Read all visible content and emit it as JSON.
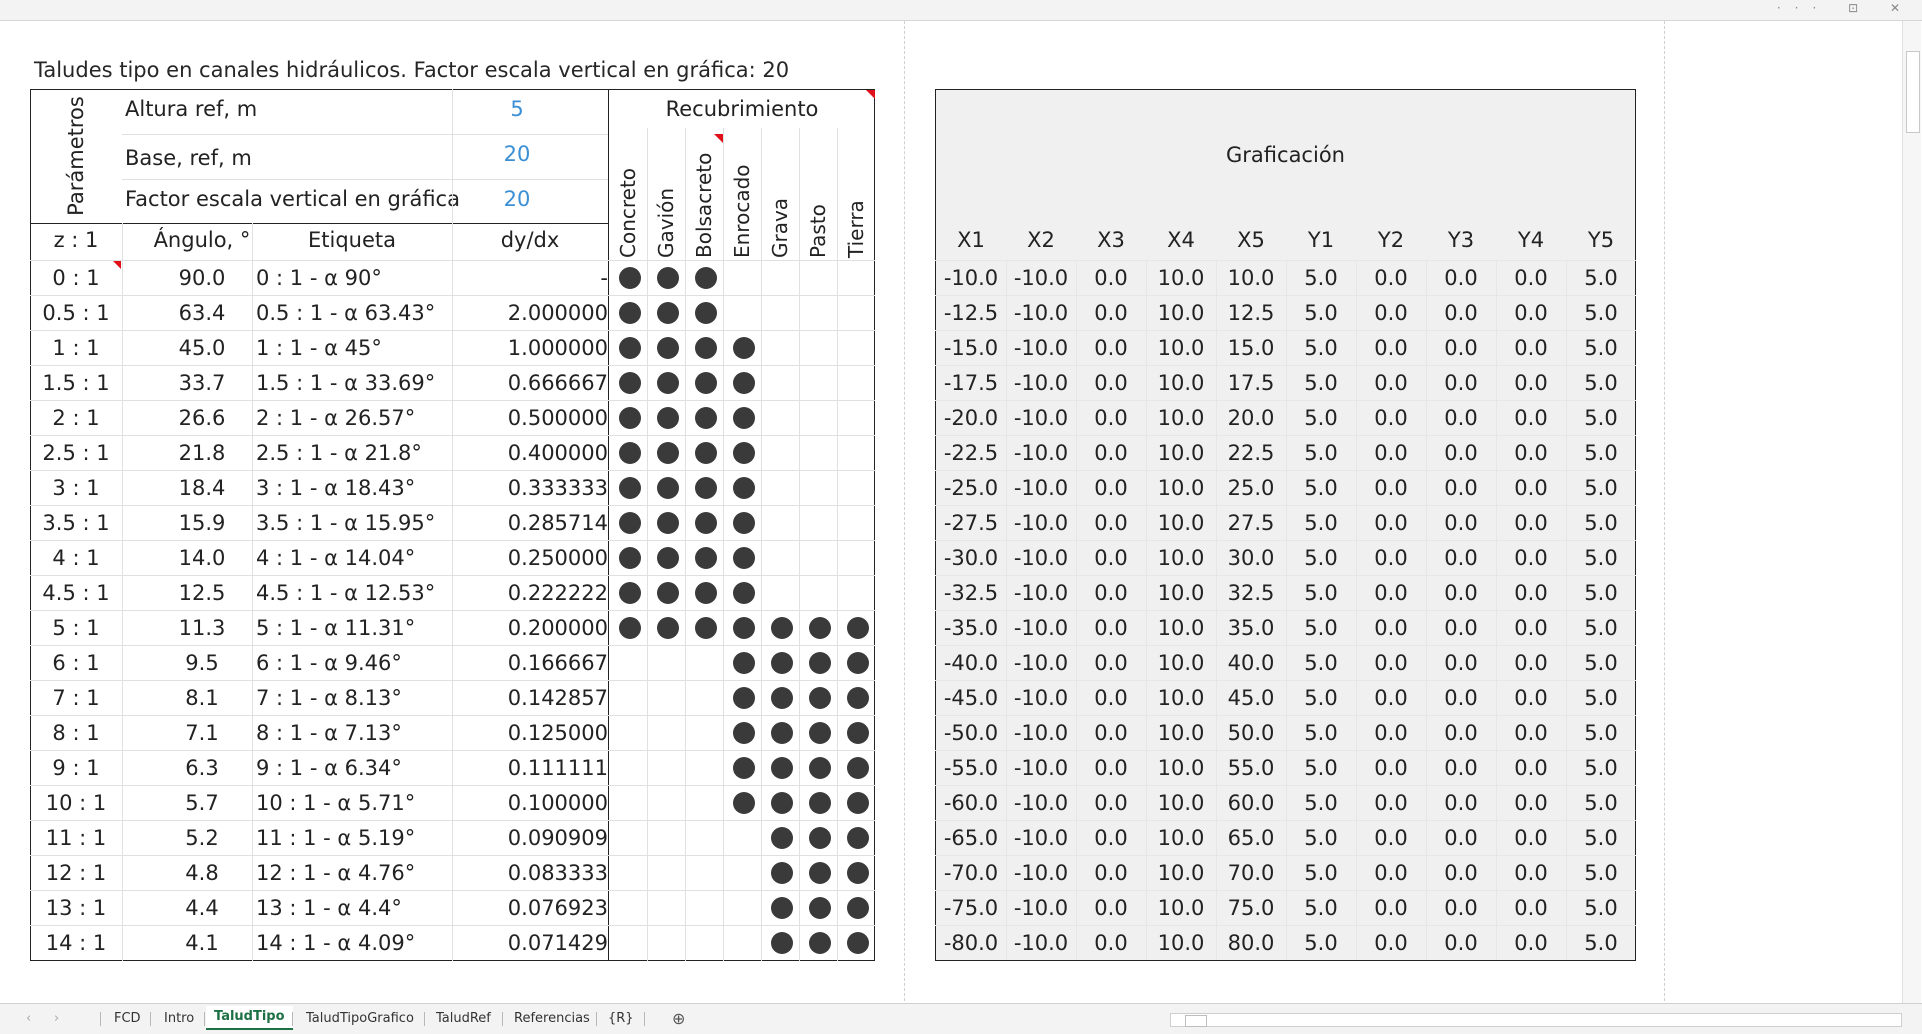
{
  "window": {
    "menu_icons": "··· ⊡ ✕"
  },
  "title": "Taludes tipo en canales hidráulicos. Factor escala vertical en gráfica: 20",
  "params": {
    "section_label": "Parámetros",
    "rows": [
      {
        "label": "Altura ref, m",
        "value": "5"
      },
      {
        "label": "Base, ref, m",
        "value": "20"
      },
      {
        "label": "Factor escala vertical en gráfica",
        "value": "20"
      }
    ]
  },
  "left_headers": {
    "z": "z : 1",
    "angle": "Ángulo, °",
    "label": "Etiqueta",
    "dydx": "dy/dx"
  },
  "recubrimiento": {
    "title": "Recubrimiento",
    "columns": [
      "Concreto",
      "Gavión",
      "Bolsacreto",
      "Enrocado",
      "Grava",
      "Pasto",
      "Tierra"
    ]
  },
  "rows": [
    {
      "z": "0 : 1",
      "ang": "90.0",
      "lab": "0 : 1 - α 90°",
      "dy": "-",
      "dots": [
        1,
        1,
        1,
        0,
        0,
        0,
        0
      ]
    },
    {
      "z": "0.5 : 1",
      "ang": "63.4",
      "lab": "0.5 : 1 - α 63.43°",
      "dy": "2.000000",
      "dots": [
        1,
        1,
        1,
        0,
        0,
        0,
        0
      ]
    },
    {
      "z": "1 : 1",
      "ang": "45.0",
      "lab": "1 : 1 - α 45°",
      "dy": "1.000000",
      "dots": [
        1,
        1,
        1,
        1,
        0,
        0,
        0
      ]
    },
    {
      "z": "1.5 : 1",
      "ang": "33.7",
      "lab": "1.5 : 1 - α 33.69°",
      "dy": "0.666667",
      "dots": [
        1,
        1,
        1,
        1,
        0,
        0,
        0
      ]
    },
    {
      "z": "2 : 1",
      "ang": "26.6",
      "lab": "2 : 1 - α 26.57°",
      "dy": "0.500000",
      "dots": [
        1,
        1,
        1,
        1,
        0,
        0,
        0
      ]
    },
    {
      "z": "2.5 : 1",
      "ang": "21.8",
      "lab": "2.5 : 1 - α 21.8°",
      "dy": "0.400000",
      "dots": [
        1,
        1,
        1,
        1,
        0,
        0,
        0
      ]
    },
    {
      "z": "3 : 1",
      "ang": "18.4",
      "lab": "3 : 1 - α 18.43°",
      "dy": "0.333333",
      "dots": [
        1,
        1,
        1,
        1,
        0,
        0,
        0
      ]
    },
    {
      "z": "3.5 : 1",
      "ang": "15.9",
      "lab": "3.5 : 1 - α 15.95°",
      "dy": "0.285714",
      "dots": [
        1,
        1,
        1,
        1,
        0,
        0,
        0
      ]
    },
    {
      "z": "4 : 1",
      "ang": "14.0",
      "lab": "4 : 1 - α 14.04°",
      "dy": "0.250000",
      "dots": [
        1,
        1,
        1,
        1,
        0,
        0,
        0
      ]
    },
    {
      "z": "4.5 : 1",
      "ang": "12.5",
      "lab": "4.5 : 1 - α 12.53°",
      "dy": "0.222222",
      "dots": [
        1,
        1,
        1,
        1,
        0,
        0,
        0
      ]
    },
    {
      "z": "5 : 1",
      "ang": "11.3",
      "lab": "5 : 1 - α 11.31°",
      "dy": "0.200000",
      "dots": [
        1,
        1,
        1,
        1,
        1,
        1,
        1
      ]
    },
    {
      "z": "6 : 1",
      "ang": "9.5",
      "lab": "6 : 1 - α 9.46°",
      "dy": "0.166667",
      "dots": [
        0,
        0,
        0,
        1,
        1,
        1,
        1
      ]
    },
    {
      "z": "7 : 1",
      "ang": "8.1",
      "lab": "7 : 1 - α 8.13°",
      "dy": "0.142857",
      "dots": [
        0,
        0,
        0,
        1,
        1,
        1,
        1
      ]
    },
    {
      "z": "8 : 1",
      "ang": "7.1",
      "lab": "8 : 1 - α 7.13°",
      "dy": "0.125000",
      "dots": [
        0,
        0,
        0,
        1,
        1,
        1,
        1
      ]
    },
    {
      "z": "9 : 1",
      "ang": "6.3",
      "lab": "9 : 1 - α 6.34°",
      "dy": "0.111111",
      "dots": [
        0,
        0,
        0,
        1,
        1,
        1,
        1
      ]
    },
    {
      "z": "10 : 1",
      "ang": "5.7",
      "lab": "10 : 1 - α 5.71°",
      "dy": "0.100000",
      "dots": [
        0,
        0,
        0,
        1,
        1,
        1,
        1
      ]
    },
    {
      "z": "11 : 1",
      "ang": "5.2",
      "lab": "11 : 1 - α 5.19°",
      "dy": "0.090909",
      "dots": [
        0,
        0,
        0,
        0,
        1,
        1,
        1
      ]
    },
    {
      "z": "12 : 1",
      "ang": "4.8",
      "lab": "12 : 1 - α 4.76°",
      "dy": "0.083333",
      "dots": [
        0,
        0,
        0,
        0,
        1,
        1,
        1
      ]
    },
    {
      "z": "13 : 1",
      "ang": "4.4",
      "lab": "13 : 1 - α 4.4°",
      "dy": "0.076923",
      "dots": [
        0,
        0,
        0,
        0,
        1,
        1,
        1
      ]
    },
    {
      "z": "14 : 1",
      "ang": "4.1",
      "lab": "14 : 1 - α 4.09°",
      "dy": "0.071429",
      "dots": [
        0,
        0,
        0,
        0,
        1,
        1,
        1
      ]
    }
  ],
  "graficacion": {
    "title": "Graficación",
    "headers": [
      "X1",
      "X2",
      "X3",
      "X4",
      "X5",
      "Y1",
      "Y2",
      "Y3",
      "Y4",
      "Y5"
    ],
    "rows": [
      [
        "-10.0",
        "-10.0",
        "0.0",
        "10.0",
        "10.0",
        "5.0",
        "0.0",
        "0.0",
        "0.0",
        "5.0"
      ],
      [
        "-12.5",
        "-10.0",
        "0.0",
        "10.0",
        "12.5",
        "5.0",
        "0.0",
        "0.0",
        "0.0",
        "5.0"
      ],
      [
        "-15.0",
        "-10.0",
        "0.0",
        "10.0",
        "15.0",
        "5.0",
        "0.0",
        "0.0",
        "0.0",
        "5.0"
      ],
      [
        "-17.5",
        "-10.0",
        "0.0",
        "10.0",
        "17.5",
        "5.0",
        "0.0",
        "0.0",
        "0.0",
        "5.0"
      ],
      [
        "-20.0",
        "-10.0",
        "0.0",
        "10.0",
        "20.0",
        "5.0",
        "0.0",
        "0.0",
        "0.0",
        "5.0"
      ],
      [
        "-22.5",
        "-10.0",
        "0.0",
        "10.0",
        "22.5",
        "5.0",
        "0.0",
        "0.0",
        "0.0",
        "5.0"
      ],
      [
        "-25.0",
        "-10.0",
        "0.0",
        "10.0",
        "25.0",
        "5.0",
        "0.0",
        "0.0",
        "0.0",
        "5.0"
      ],
      [
        "-27.5",
        "-10.0",
        "0.0",
        "10.0",
        "27.5",
        "5.0",
        "0.0",
        "0.0",
        "0.0",
        "5.0"
      ],
      [
        "-30.0",
        "-10.0",
        "0.0",
        "10.0",
        "30.0",
        "5.0",
        "0.0",
        "0.0",
        "0.0",
        "5.0"
      ],
      [
        "-32.5",
        "-10.0",
        "0.0",
        "10.0",
        "32.5",
        "5.0",
        "0.0",
        "0.0",
        "0.0",
        "5.0"
      ],
      [
        "-35.0",
        "-10.0",
        "0.0",
        "10.0",
        "35.0",
        "5.0",
        "0.0",
        "0.0",
        "0.0",
        "5.0"
      ],
      [
        "-40.0",
        "-10.0",
        "0.0",
        "10.0",
        "40.0",
        "5.0",
        "0.0",
        "0.0",
        "0.0",
        "5.0"
      ],
      [
        "-45.0",
        "-10.0",
        "0.0",
        "10.0",
        "45.0",
        "5.0",
        "0.0",
        "0.0",
        "0.0",
        "5.0"
      ],
      [
        "-50.0",
        "-10.0",
        "0.0",
        "10.0",
        "50.0",
        "5.0",
        "0.0",
        "0.0",
        "0.0",
        "5.0"
      ],
      [
        "-55.0",
        "-10.0",
        "0.0",
        "10.0",
        "55.0",
        "5.0",
        "0.0",
        "0.0",
        "0.0",
        "5.0"
      ],
      [
        "-60.0",
        "-10.0",
        "0.0",
        "10.0",
        "60.0",
        "5.0",
        "0.0",
        "0.0",
        "0.0",
        "5.0"
      ],
      [
        "-65.0",
        "-10.0",
        "0.0",
        "10.0",
        "65.0",
        "5.0",
        "0.0",
        "0.0",
        "0.0",
        "5.0"
      ],
      [
        "-70.0",
        "-10.0",
        "0.0",
        "10.0",
        "70.0",
        "5.0",
        "0.0",
        "0.0",
        "0.0",
        "5.0"
      ],
      [
        "-75.0",
        "-10.0",
        "0.0",
        "10.0",
        "75.0",
        "5.0",
        "0.0",
        "0.0",
        "0.0",
        "5.0"
      ],
      [
        "-80.0",
        "-10.0",
        "0.0",
        "10.0",
        "80.0",
        "5.0",
        "0.0",
        "0.0",
        "0.0",
        "5.0"
      ]
    ]
  },
  "tabs": {
    "nav_prev": "‹",
    "nav_next": "›",
    "items": [
      {
        "label": "FCD",
        "active": false
      },
      {
        "label": "Intro",
        "active": false
      },
      {
        "label": "TaludTipo",
        "active": true
      },
      {
        "label": "TaludTipoGrafico",
        "active": false
      },
      {
        "label": "TaludRef",
        "active": false
      },
      {
        "label": "Referencias",
        "active": false
      },
      {
        "label": "{R}",
        "active": false
      }
    ],
    "add_label": "⊕"
  },
  "colors": {
    "accent_value": "#3b8fd4",
    "active_tab": "#1e7145",
    "comment_marker": "#e0101a",
    "dot": "#3a3a3a"
  }
}
